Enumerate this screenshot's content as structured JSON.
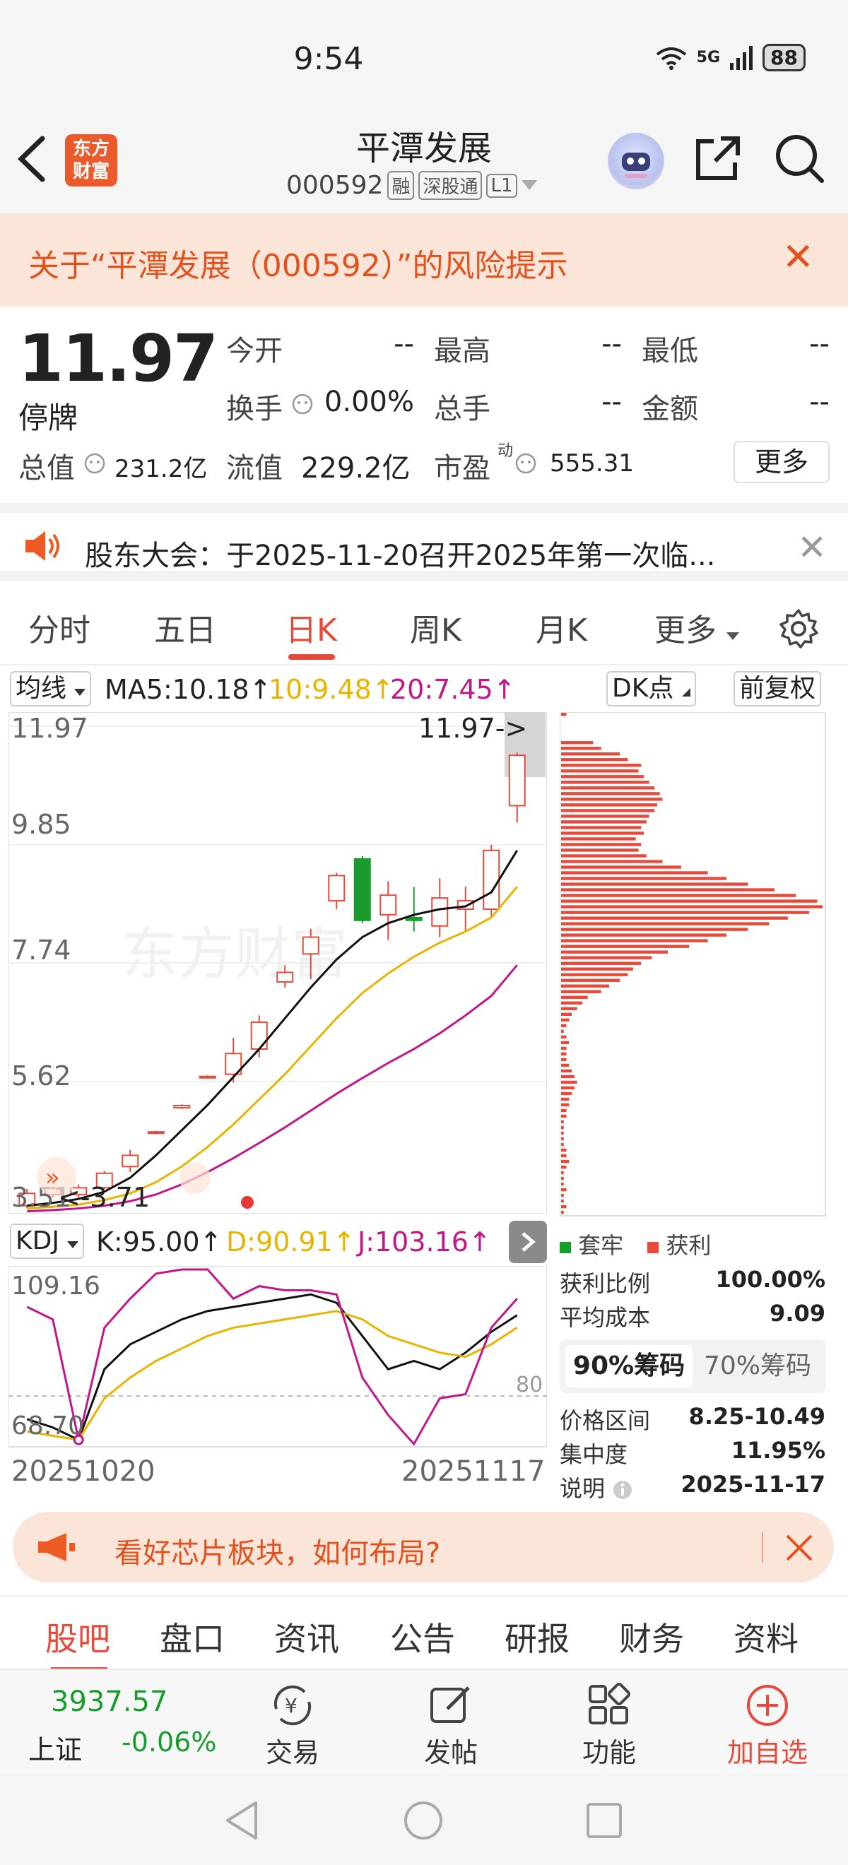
{
  "status": {
    "time": "9:54",
    "network": "5G",
    "battery": "88"
  },
  "header": {
    "logo": [
      "东方",
      "财富"
    ],
    "name": "平潭发展",
    "code": "000592",
    "tags": [
      "融",
      "深股通",
      "L1"
    ]
  },
  "risk": {
    "text": "关于“平潭发展（000592）”的风险提示",
    "close": "✕"
  },
  "quote": {
    "price": "11.97",
    "status": "停牌",
    "open_label": "今开",
    "open_value": "--",
    "high_label": "最高",
    "high_value": "--",
    "low_label": "最低",
    "low_value": "--",
    "turnover_label": "换手",
    "turnover_value": "0.00%",
    "volume_label": "总手",
    "volume_value": "--",
    "amount_label": "金额",
    "amount_value": "--",
    "mktcap_label": "总值",
    "mktcap_value": "231.2亿",
    "float_label": "流值",
    "float_value": "229.2亿",
    "pe_label": "市盈",
    "pe_sup": "动",
    "pe_value": "555.31",
    "more": "更多"
  },
  "notice": {
    "text": "股东大会：于2025-11-20召开2025年第一次临...",
    "close": "✕"
  },
  "chart_tabs": [
    "分时",
    "五日",
    "日K",
    "周K",
    "月K",
    "更多"
  ],
  "ma_row": {
    "selector": "均线",
    "ma5": "MA5:10.18↑",
    "ma10": "10:9.48↑",
    "ma20": "20:7.45↑",
    "dk": "DK点",
    "adjust": "前复权"
  },
  "kchart": {
    "y_labels": [
      "11.97",
      "9.85",
      "7.74",
      "5.62",
      "3.51"
    ],
    "high_marker": "11.97->",
    "low_marker": "<-3.71",
    "watermark": "东方财富"
  },
  "indicator": {
    "selector": "KDJ",
    "k": "K:95.00↑",
    "d": "D:90.91↑",
    "j": "J:103.16↑",
    "top": "109.16",
    "bottom": "68.70",
    "ref": "80"
  },
  "dates": {
    "start": "20251020",
    "end": "20251117"
  },
  "chips": {
    "legend_trapped": "套牢",
    "legend_profit": "获利",
    "profit_ratio_label": "获利比例",
    "profit_ratio_value": "100.00%",
    "avg_cost_label": "平均成本",
    "avg_cost_value": "9.09",
    "tab_90": "90%筹码",
    "tab_70": "70%筹码",
    "range_label": "价格区间",
    "range_value": "8.25-10.49",
    "concentration_label": "集中度",
    "concentration_value": "11.95%",
    "note_label": "说明",
    "note_value": "2025-11-17"
  },
  "ad": {
    "text": "看好芯片板块，如何布局?"
  },
  "bottom_tabs": [
    "股吧",
    "盘口",
    "资讯",
    "公告",
    "研报",
    "财务",
    "资料"
  ],
  "nav": {
    "index_value": "3937.57",
    "index_name": "上证",
    "index_change": "-0.06%",
    "items": [
      "交易",
      "发帖",
      "功能",
      "加自选"
    ]
  },
  "colors": {
    "accent": "#e64a3b",
    "up": "#e64a3b",
    "down": "#1a9b2e",
    "ma10": "#e8b400",
    "ma20": "#c2168a"
  },
  "chart_data": {
    "type": "candlestick",
    "x_range": [
      "20251020",
      "20251117"
    ],
    "ylim": [
      3.51,
      11.97
    ],
    "candles": [
      {
        "o": 3.4,
        "c": 3.62,
        "h": 3.7,
        "l": 3.35
      },
      {
        "o": 3.6,
        "c": 3.71,
        "h": 3.75,
        "l": 3.55
      },
      {
        "o": 3.6,
        "c": 3.72,
        "h": 3.78,
        "l": 3.52
      },
      {
        "o": 3.72,
        "c": 3.98,
        "h": 4.02,
        "l": 3.7
      },
      {
        "o": 4.1,
        "c": 4.3,
        "h": 4.4,
        "l": 4.0
      },
      {
        "o": 4.7,
        "c": 4.72,
        "h": 4.74,
        "l": 4.68
      },
      {
        "o": 5.15,
        "c": 5.19,
        "h": 5.21,
        "l": 5.13
      },
      {
        "o": 5.7,
        "c": 5.71,
        "h": 5.73,
        "l": 5.68
      },
      {
        "o": 5.75,
        "c": 6.12,
        "h": 6.4,
        "l": 5.6
      },
      {
        "o": 6.2,
        "c": 6.68,
        "h": 6.8,
        "l": 6.05
      },
      {
        "o": 7.4,
        "c": 7.57,
        "h": 7.7,
        "l": 7.3
      },
      {
        "o": 7.9,
        "c": 8.2,
        "h": 8.35,
        "l": 7.45
      },
      {
        "o": 8.85,
        "c": 9.3,
        "h": 9.35,
        "l": 8.7
      },
      {
        "o": 9.6,
        "c": 8.5,
        "h": 9.65,
        "l": 8.45
      },
      {
        "o": 8.6,
        "c": 8.95,
        "h": 9.2,
        "l": 8.15
      },
      {
        "o": 8.55,
        "c": 8.5,
        "h": 9.1,
        "l": 8.3
      },
      {
        "o": 8.4,
        "c": 8.9,
        "h": 9.25,
        "l": 8.2
      },
      {
        "o": 8.7,
        "c": 8.85,
        "h": 9.1,
        "l": 8.3
      },
      {
        "o": 8.7,
        "c": 9.75,
        "h": 9.85,
        "l": 8.55
      },
      {
        "o": 10.55,
        "c": 11.45,
        "h": 11.5,
        "l": 10.25
      }
    ],
    "series": [
      {
        "name": "MA5",
        "values": [
          3.4,
          3.45,
          3.52,
          3.65,
          3.9,
          4.3,
          4.75,
          5.2,
          5.7,
          6.2,
          6.75,
          7.3,
          7.8,
          8.2,
          8.45,
          8.6,
          8.7,
          8.75,
          9.0,
          9.75
        ]
      },
      {
        "name": "MA10",
        "values": [
          3.35,
          3.38,
          3.42,
          3.5,
          3.62,
          3.82,
          4.1,
          4.45,
          4.85,
          5.3,
          5.75,
          6.25,
          6.75,
          7.2,
          7.55,
          7.85,
          8.1,
          8.3,
          8.55,
          9.1
        ]
      },
      {
        "name": "MA20",
        "values": [
          3.3,
          3.32,
          3.35,
          3.4,
          3.48,
          3.6,
          3.78,
          4.0,
          4.25,
          4.52,
          4.8,
          5.1,
          5.4,
          5.68,
          5.95,
          6.2,
          6.48,
          6.8,
          7.15,
          7.7
        ]
      }
    ],
    "kdj": {
      "K": [
        74,
        72,
        69,
        86,
        92,
        95,
        98,
        100,
        101,
        102,
        103,
        104,
        102,
        94,
        86,
        88,
        86,
        90,
        95,
        99
      ],
      "D": [
        71,
        70,
        69,
        79,
        84,
        88,
        91,
        94,
        96,
        97,
        98,
        99,
        100,
        98,
        94,
        92,
        90,
        89,
        92,
        96
      ],
      "J": [
        101,
        98,
        69,
        96,
        103,
        109,
        110,
        110,
        103,
        106,
        105,
        105,
        104,
        84,
        75,
        68,
        79,
        80,
        96,
        103
      ],
      "ylim": [
        68.7,
        109.16
      ]
    },
    "chip_distribution": [
      2,
      0,
      0,
      0,
      0,
      12,
      15,
      22,
      25,
      30,
      29,
      31,
      33,
      35,
      37,
      38,
      36,
      35,
      33,
      32,
      30,
      31,
      28,
      30,
      29,
      32,
      38,
      45,
      55,
      62,
      70,
      80,
      88,
      96,
      98,
      93,
      85,
      78,
      70,
      62,
      55,
      48,
      40,
      34,
      30,
      27,
      25,
      22,
      18,
      15,
      10,
      8,
      6,
      4,
      3,
      2,
      1,
      2,
      3,
      2,
      2,
      2,
      3,
      4,
      5,
      6,
      5,
      4,
      3,
      3,
      2,
      2,
      1,
      1,
      1,
      1,
      1,
      2,
      2,
      3,
      2,
      1,
      1,
      1,
      2,
      1,
      1,
      2,
      1
    ]
  }
}
